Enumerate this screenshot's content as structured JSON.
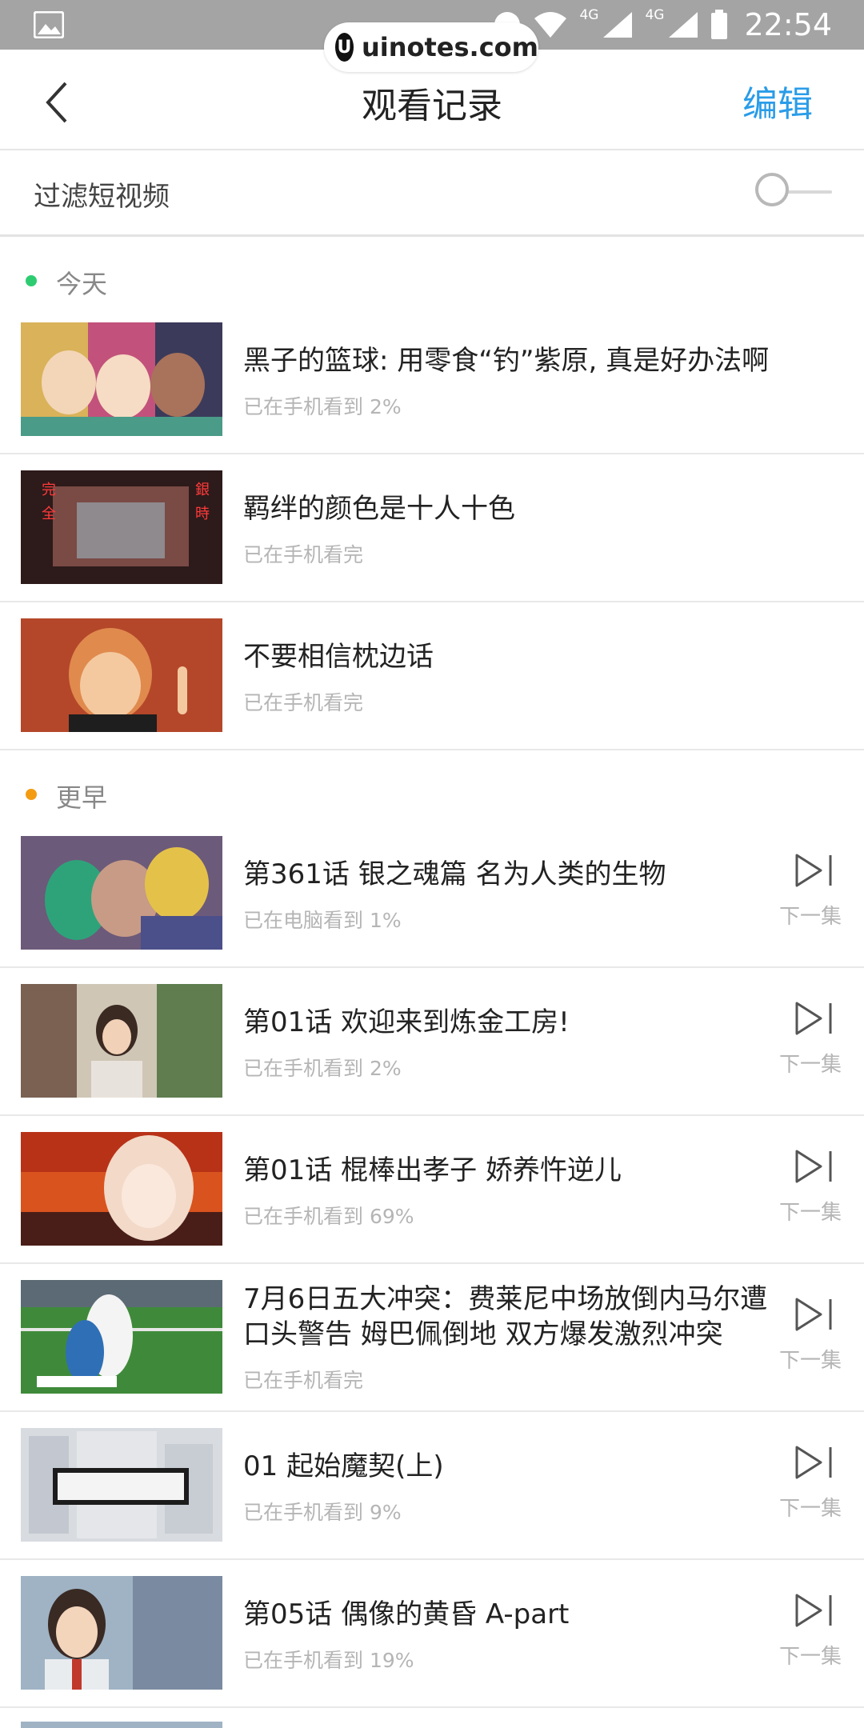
{
  "status_bar": {
    "time": "22:54",
    "network1": "4G",
    "network2": "4G",
    "icons": [
      "photo-icon",
      "dnd-icon",
      "wifi-icon",
      "signal-icon",
      "battery-icon"
    ]
  },
  "watermark": {
    "logo": "U",
    "text": "uinotes.com"
  },
  "header": {
    "title": "观看记录",
    "edit_label": "编辑",
    "accent": "#2a9ce8"
  },
  "filter": {
    "label": "过滤短视频",
    "enabled": false
  },
  "sections": [
    {
      "label": "今天",
      "dot_color": "#2ecc71",
      "items": [
        {
          "title": "黑子的篮球: 用零食“钓”紫原, 真是好办法啊",
          "progress": "已在手机看到 2%",
          "has_next": false
        },
        {
          "title": "羁绊的颜色是十人十色",
          "progress": "已在手机看完",
          "has_next": false
        },
        {
          "title": "不要相信枕边话",
          "progress": "已在手机看完",
          "has_next": false
        }
      ]
    },
    {
      "label": "更早",
      "dot_color": "#f39c12",
      "items": [
        {
          "title": "第361话 银之魂篇 名为人类的生物",
          "progress": "已在电脑看到 1%",
          "has_next": true,
          "next_label": "下一集"
        },
        {
          "title": "第01话 欢迎来到炼金工房!",
          "progress": "已在手机看到 2%",
          "has_next": true,
          "next_label": "下一集"
        },
        {
          "title": "第01话 棍棒出孝子 娇养忤逆儿",
          "progress": "已在手机看到 69%",
          "has_next": true,
          "next_label": "下一集"
        },
        {
          "title": "7月6日五大冲突：费莱尼中场放倒内马尔遭口头警告 姆巴佩倒地 双方爆发激烈冲突",
          "progress": "已在手机看完",
          "has_next": true,
          "next_label": "下一集"
        },
        {
          "title": "01 起始魔契(上)",
          "progress": "已在手机看到 9%",
          "has_next": true,
          "next_label": "下一集"
        },
        {
          "title": "第05话 偶像的黄昏 A-part",
          "progress": "已在手机看到 19%",
          "has_next": true,
          "next_label": "下一集"
        }
      ]
    }
  ]
}
